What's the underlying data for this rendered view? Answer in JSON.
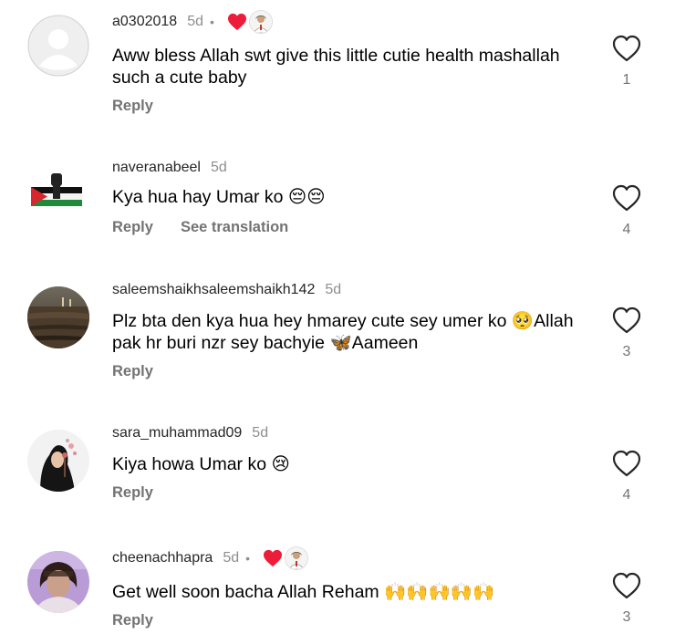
{
  "comments": [
    {
      "username": "a0302018",
      "time": "5d",
      "dot": "•",
      "text": "Aww bless Allah swt give this little cutie health mashallah such a cute baby",
      "reply_label": "Reply",
      "like_count": "1",
      "liked_by_author": true,
      "avatar": "default-avatar"
    },
    {
      "username": "naveranabeel",
      "time": "5d",
      "text": "Kya hua hay Umar ko 😔😔",
      "reply_label": "Reply",
      "translate_label": "See translation",
      "like_count": "4",
      "avatar": "palestine-flag-fist"
    },
    {
      "username": "saleemshaikhsaleemshaikh142",
      "time": "5d",
      "text": "Plz bta den kya hua hey hmarey cute sey umer ko 🥺Allah pak hr buri nzr sey bachyie 🦋Aameen",
      "reply_label": "Reply",
      "like_count": "3",
      "avatar": "landscape-photo"
    },
    {
      "username": "sara_muhammad09",
      "time": "5d",
      "text": "Kiya howa Umar ko 😢",
      "reply_label": "Reply",
      "like_count": "4",
      "avatar": "hijab-illustration"
    },
    {
      "username": "cheenachhapra",
      "time": "5d",
      "dot": "•",
      "text": "Get well soon bacha Allah Reham 🙌🙌🙌🙌🙌",
      "reply_label": "Reply",
      "like_count": "3",
      "liked_by_author": true,
      "avatar": "woman-photo"
    }
  ],
  "colors": {
    "username": "#262626",
    "secondary": "#737373",
    "author_heart": "#ed1c38"
  }
}
